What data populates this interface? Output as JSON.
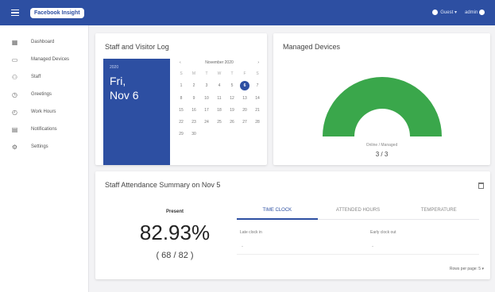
{
  "topbar": {
    "brand": "Facebook Insight",
    "user_menu_label": "Guest",
    "user_name": "admin"
  },
  "sidebar": {
    "items": [
      {
        "label": "Dashboard",
        "icon": "grid-icon"
      },
      {
        "label": "Managed Devices",
        "icon": "devices-icon"
      },
      {
        "label": "Staff",
        "icon": "people-icon"
      },
      {
        "label": "Greetings",
        "icon": "clock-icon"
      },
      {
        "label": "Work Hours",
        "icon": "timer-icon"
      },
      {
        "label": "Notifications",
        "icon": "calendar-icon"
      },
      {
        "label": "Settings",
        "icon": "gear-icon"
      }
    ]
  },
  "visitor_log": {
    "title": "Staff and Visitor Log",
    "year": "2020",
    "weekday": "Fri,",
    "date": "Nov 6",
    "calendar_month": "November 2020",
    "weekdays": [
      "S",
      "M",
      "T",
      "W",
      "T",
      "F",
      "S"
    ],
    "days": [
      "1",
      "2",
      "3",
      "4",
      "5",
      "6",
      "7",
      "8",
      "9",
      "10",
      "11",
      "12",
      "13",
      "14",
      "15",
      "16",
      "17",
      "18",
      "19",
      "20",
      "21",
      "22",
      "23",
      "24",
      "25",
      "26",
      "27",
      "28",
      "29",
      "30"
    ],
    "first_weekday_offset": 0,
    "selected_day": "6"
  },
  "devices": {
    "title": "Managed Devices",
    "gauge_label": "Online / Managed",
    "online": 3,
    "managed": 3,
    "value_text": "3 / 3",
    "accent": "#3aa74b"
  },
  "attendance": {
    "title": "Staff Attendance Summary on Nov 5",
    "present_label": "Present",
    "percent": "82.93%",
    "ratio": "( 68 / 82 )",
    "tabs": [
      "TIME CLOCK",
      "ATTENDED HOURS",
      "TEMPERATURE"
    ],
    "active_tab": 0,
    "columns": [
      "Late clock in",
      "Early clock out"
    ],
    "values": [
      "-",
      "-"
    ],
    "pager": "Rows per page: 5"
  },
  "colors": {
    "primary": "#2d4fa2",
    "gauge": "#3aa74b"
  }
}
